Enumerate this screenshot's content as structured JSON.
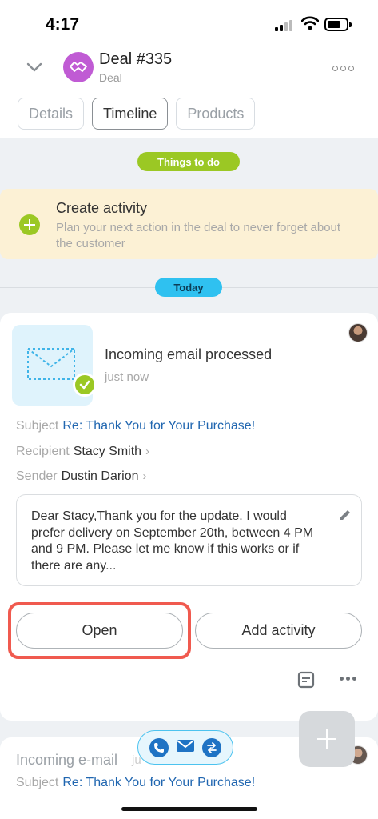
{
  "status_bar": {
    "time": "4:17"
  },
  "header": {
    "title": "Deal #335",
    "subtitle": "Deal",
    "tabs": [
      {
        "label": "Details",
        "active": false
      },
      {
        "label": "Timeline",
        "active": true
      },
      {
        "label": "Products",
        "active": false
      }
    ]
  },
  "things_to_do": {
    "pill": "Things to do",
    "create_title": "Create activity",
    "create_desc": "Plan your next action in the deal to never forget about the customer"
  },
  "today_pill": "Today",
  "event": {
    "title": "Incoming email processed",
    "time": "just now",
    "subject_label": "Subject",
    "subject_value": "Re: Thank You for Your Purchase!",
    "recipient_label": "Recipient",
    "recipient_value": "Stacy Smith",
    "sender_label": "Sender",
    "sender_value": "Dustin Darion",
    "body": "Dear Stacy,Thank you for the update. I would prefer delivery on September 20th, between 4 PM and 9 PM. Please let me know if this works or if there are any...",
    "open_label": "Open",
    "add_activity_label": "Add activity"
  },
  "next_event": {
    "title": "Incoming e-mail",
    "time": "ju",
    "subject_label": "Subject",
    "subject_value": "Re: Thank You for Your Purchase!"
  },
  "colors": {
    "accent_green": "#9bc824",
    "accent_blue": "#2fc1f0",
    "link": "#2066b0",
    "highlight": "#f05a4f",
    "deal_avatar": "#c05bd4"
  },
  "icons": [
    "chevron-down-icon",
    "handshake-icon",
    "more-icon",
    "plus-icon",
    "envelope-icon",
    "check-icon",
    "pencil-icon",
    "note-icon",
    "phone-icon",
    "mail-icon",
    "transfer-icon"
  ]
}
